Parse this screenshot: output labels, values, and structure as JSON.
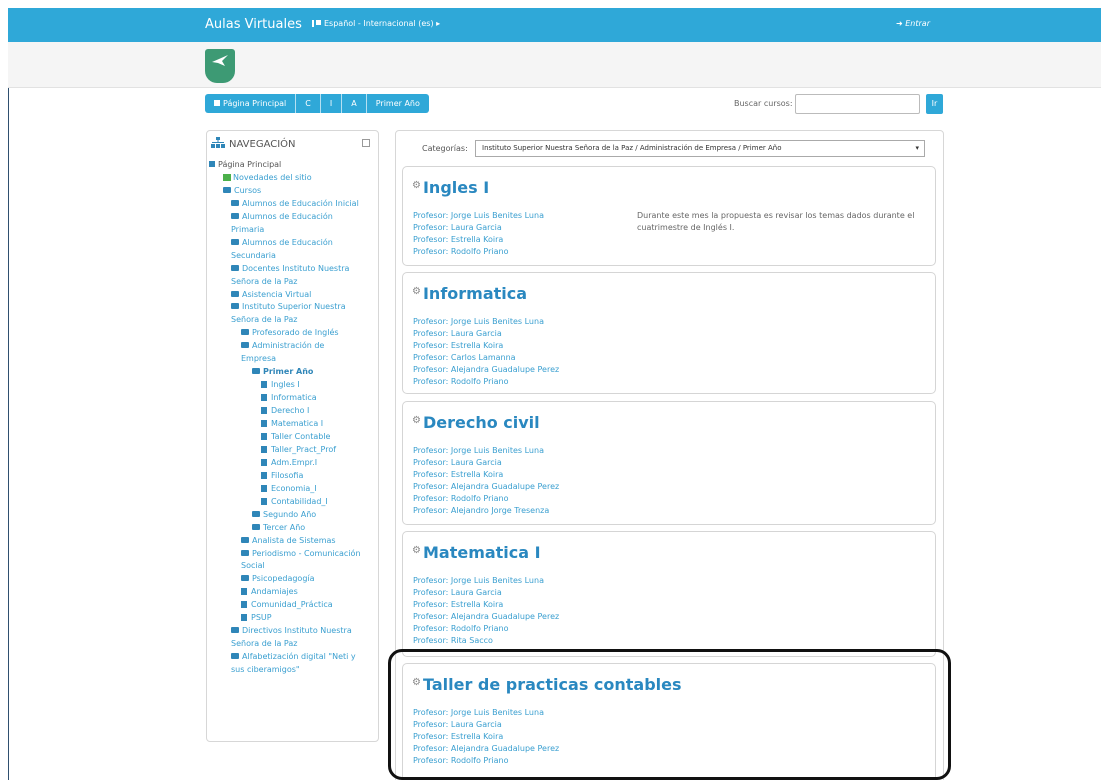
{
  "topbar": {
    "site_name": "Aulas Virtuales",
    "language": "Español - Internacional (es) ▸",
    "login": "Entrar"
  },
  "breadcrumb": [
    "Página Principal",
    "C",
    "I",
    "A",
    "Primer Año"
  ],
  "search": {
    "label": "Buscar cursos:",
    "value": "",
    "button": "Ir"
  },
  "navigation": {
    "title": "NAVEGACIÓN",
    "items": [
      {
        "label": "Página Principal",
        "level": 0,
        "icon": "home-icon"
      },
      {
        "label": "Novedades del sitio",
        "level": 1,
        "icon": "news-icon"
      },
      {
        "label": "Cursos",
        "level": 1,
        "icon": "folder-open-icon"
      },
      {
        "label": "Alumnos de Educación Inicial",
        "level": 2,
        "icon": "folder-icon"
      },
      {
        "label": "Alumnos de Educación",
        "level": 2,
        "icon": "folder-icon"
      },
      {
        "label": "Primaria",
        "level": 2,
        "icon": ""
      },
      {
        "label": "Alumnos de Educación",
        "level": 2,
        "icon": "folder-icon"
      },
      {
        "label": "Secundaria",
        "level": 2,
        "icon": ""
      },
      {
        "label": "Docentes Instituto Nuestra",
        "level": 2,
        "icon": "folder-icon"
      },
      {
        "label": "Señora de la Paz",
        "level": 2,
        "icon": ""
      },
      {
        "label": "Asistencia Virtual",
        "level": 2,
        "icon": "folder-icon"
      },
      {
        "label": "Instituto Superior Nuestra",
        "level": 2,
        "icon": "folder-open-icon"
      },
      {
        "label": "Señora de la Paz",
        "level": 2,
        "icon": ""
      },
      {
        "label": "Profesorado de Inglés",
        "level": 3,
        "icon": "folder-icon"
      },
      {
        "label": "Administración de",
        "level": 3,
        "icon": "folder-open-icon"
      },
      {
        "label": "Empresa",
        "level": 3,
        "icon": ""
      },
      {
        "label": "Primer Año",
        "level": 4,
        "icon": "folder-open-icon"
      },
      {
        "label": "Ingles I",
        "level": 5,
        "icon": "course-icon"
      },
      {
        "label": "Informatica",
        "level": 5,
        "icon": "course-icon"
      },
      {
        "label": "Derecho I",
        "level": 5,
        "icon": "course-icon"
      },
      {
        "label": "Matematica I",
        "level": 5,
        "icon": "course-icon"
      },
      {
        "label": "Taller Contable",
        "level": 5,
        "icon": "course-icon"
      },
      {
        "label": "Taller_Pract_Prof",
        "level": 5,
        "icon": "course-icon"
      },
      {
        "label": "Adm.Empr.I",
        "level": 5,
        "icon": "course-icon"
      },
      {
        "label": "Filosofia",
        "level": 5,
        "icon": "course-icon"
      },
      {
        "label": "Economia_I",
        "level": 5,
        "icon": "course-icon"
      },
      {
        "label": "Contabilidad_I",
        "level": 5,
        "icon": "course-icon"
      },
      {
        "label": "Segundo Año",
        "level": 4,
        "icon": "folder-icon"
      },
      {
        "label": "Tercer Año",
        "level": 4,
        "icon": "folder-icon"
      },
      {
        "label": "Analista de Sistemas",
        "level": 3,
        "icon": "folder-icon"
      },
      {
        "label": "Periodismo - Comunicación",
        "level": 3,
        "icon": "folder-icon"
      },
      {
        "label": "Social",
        "level": 3,
        "icon": ""
      },
      {
        "label": "Psicopedagogía",
        "level": 3,
        "icon": "folder-icon"
      },
      {
        "label": "Andamiajes",
        "level": 3,
        "icon": "course-icon"
      },
      {
        "label": "Comunidad_Práctica",
        "level": 3,
        "icon": "course-icon"
      },
      {
        "label": "PSUP",
        "level": 3,
        "icon": "course-icon"
      },
      {
        "label": "Directivos Instituto Nuestra",
        "level": 2,
        "icon": "folder-icon"
      },
      {
        "label": "Señora de la Paz",
        "level": 2,
        "icon": ""
      },
      {
        "label": "Alfabetización digital \"Neti y",
        "level": 2,
        "icon": "folder-icon"
      },
      {
        "label": "sus ciberamigos\"",
        "level": 2,
        "icon": ""
      }
    ]
  },
  "category": {
    "label": "Categorías:",
    "selected": "Instituto Superior Nuestra Señora de la Paz / Administración de Empresa / Primer Año"
  },
  "courses": [
    {
      "title": "Ingles I",
      "teachers": [
        "Profesor: Jorge Luis Benites Luna",
        "Profesor: Laura Garcia",
        "Profesor: Estrella Koira",
        "Profesor: Rodolfo Priano"
      ],
      "summary": "Durante este mes la propuesta es revisar los temas dados durante el cuatrimestre de Inglés I."
    },
    {
      "title": "Informatica",
      "teachers": [
        "Profesor: Jorge Luis Benites Luna",
        "Profesor: Laura Garcia",
        "Profesor: Estrella Koira",
        "Profesor: Carlos Lamanna",
        "Profesor: Alejandra Guadalupe Perez",
        "Profesor: Rodolfo Priano"
      ],
      "summary": ""
    },
    {
      "title": "Derecho civil",
      "teachers": [
        "Profesor: Jorge Luis Benites Luna",
        "Profesor: Laura Garcia",
        "Profesor: Estrella Koira",
        "Profesor: Alejandra Guadalupe Perez",
        "Profesor: Rodolfo Priano",
        "Profesor: Alejandro Jorge Tresenza"
      ],
      "summary": ""
    },
    {
      "title": "Matematica I",
      "teachers": [
        "Profesor: Jorge Luis Benites Luna",
        "Profesor: Laura Garcia",
        "Profesor: Estrella Koira",
        "Profesor: Alejandra Guadalupe Perez",
        "Profesor: Rodolfo Priano",
        "Profesor: Rita Sacco"
      ],
      "summary": ""
    },
    {
      "title": "Taller de practicas contables",
      "teachers": [
        "Profesor: Jorge Luis Benites Luna",
        "Profesor: Laura Garcia",
        "Profesor: Estrella Koira",
        "Profesor: Alejandra Guadalupe Perez",
        "Profesor: Rodolfo Priano"
      ],
      "summary": ""
    }
  ],
  "colors": {
    "accent": "#2fa8d8",
    "link": "#3a9fd0",
    "title": "#2a88c0"
  }
}
